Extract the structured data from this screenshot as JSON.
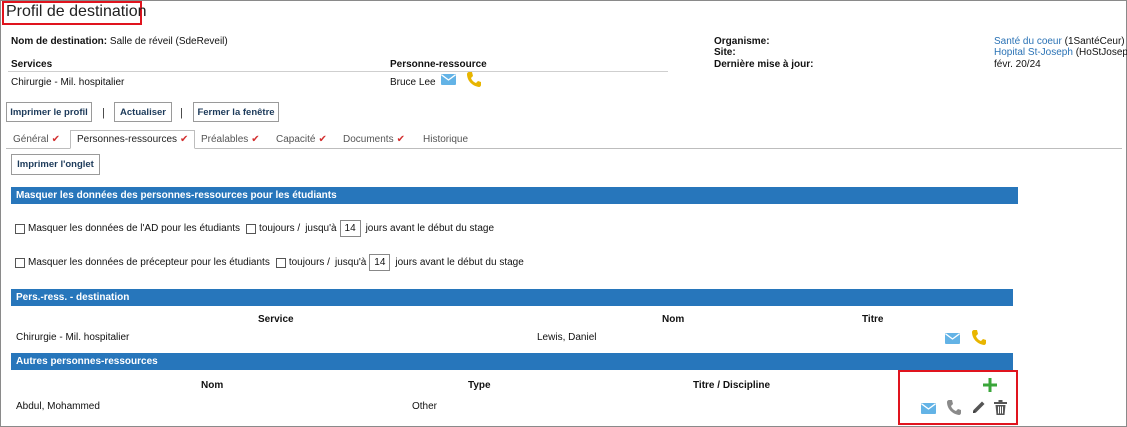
{
  "page": {
    "title": "Profil de destination"
  },
  "header": {
    "destination_label": "Nom de destination:",
    "destination_value": "Salle de réveil (SdeReveil)",
    "services_label": "Services",
    "contact_label": "Personne-ressource",
    "service_value": "Chirurgie - Mil. hospitalier",
    "contact_value": "Bruce Lee",
    "org_label": "Organisme:",
    "site_label": "Site:",
    "updated_label": "Dernière mise à jour:",
    "org_link": "Santé du coeur",
    "org_code": "(1SantéCeur)",
    "site_link": "Hopital St-Joseph",
    "site_code": "(HoStJoseph)",
    "updated_value": "févr. 20/24"
  },
  "toolbar": {
    "print_profile": "Imprimer le profil",
    "refresh": "Actualiser",
    "close_window": "Fermer la fenêtre",
    "separator": "|"
  },
  "tabs": [
    {
      "label": "Général"
    },
    {
      "label": "Personnes-ressources"
    },
    {
      "label": "Préalables"
    },
    {
      "label": "Capacité"
    },
    {
      "label": "Documents"
    },
    {
      "label": "Historique"
    }
  ],
  "print_tab": "Imprimer l'onglet",
  "mask": {
    "header": "Masquer les données des personnes-ressources pour les étudiants",
    "row1_label": "Masquer les données de l'AD pour les étudiants",
    "row2_label": "Masquer les données de précepteur pour les étudiants",
    "always": "toujours /",
    "until": "jusqu'à",
    "days_value": "14",
    "days_suffix": "jours avant le début du stage"
  },
  "destination_contacts": {
    "header": "Pers.-ress. - destination",
    "col_service": "Service",
    "col_name": "Nom",
    "col_title": "Titre",
    "row_service": "Chirurgie - Mil. hospitalier",
    "row_name": "Lewis, Daniel"
  },
  "other_contacts": {
    "header": "Autres personnes-ressources",
    "col_name": "Nom",
    "col_type": "Type",
    "col_title": "Titre / Discipline",
    "row_name": "Abdul, Mohammed",
    "row_type": "Other"
  },
  "colors": {
    "section_blue": "#2776bb",
    "link_blue": "#2a72b5",
    "phone_yellow": "#e8b500",
    "add_green": "#3aa63a",
    "highlight_red": "#e0141e"
  },
  "icons": [
    "envelope-icon",
    "phone-icon",
    "plus-icon",
    "pencil-icon",
    "trash-icon",
    "checkmark-icon"
  ]
}
